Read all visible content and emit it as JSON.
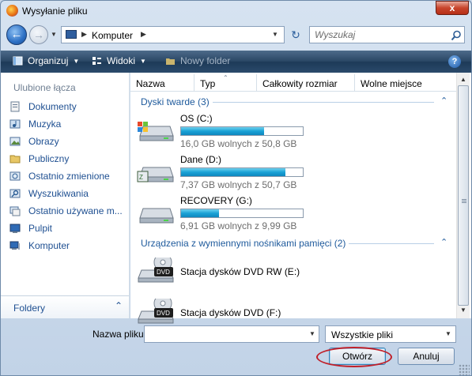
{
  "window": {
    "title": "Wysyłanie pliku",
    "close_glyph": "x"
  },
  "nav": {
    "address_segment": "Komputer",
    "search_placeholder": "Wyszukaj"
  },
  "toolbar": {
    "organize_label": "Organizuj",
    "views_label": "Widoki",
    "new_folder_label": "Nowy folder",
    "help_glyph": "?"
  },
  "sidebar": {
    "header": "Ulubione łącza",
    "items": [
      {
        "label": "Dokumenty",
        "icon": "documents-icon"
      },
      {
        "label": "Muzyka",
        "icon": "music-icon"
      },
      {
        "label": "Obrazy",
        "icon": "pictures-icon"
      },
      {
        "label": "Publiczny",
        "icon": "public-folder-icon"
      },
      {
        "label": "Ostatnio zmienione",
        "icon": "recent-icon"
      },
      {
        "label": "Wyszukiwania",
        "icon": "searches-icon"
      },
      {
        "label": "Ostatnio używane m...",
        "icon": "recent-places-icon"
      },
      {
        "label": "Pulpit",
        "icon": "desktop-icon"
      },
      {
        "label": "Komputer",
        "icon": "computer-icon"
      }
    ],
    "folders_label": "Foldery"
  },
  "columns": {
    "name": "Nazwa",
    "type": "Typ",
    "total_size": "Całkowity rozmiar",
    "free_space": "Wolne miejsce"
  },
  "groups": {
    "hard_disks": "Dyski twarde (3)",
    "removable": "Urządzenia z wymiennymi nośnikami pamięci (2)"
  },
  "drives": [
    {
      "name": "OS (C:)",
      "free_text": "16,0 GB wolnych z 50,8 GB",
      "used_fraction": 0.685
    },
    {
      "name": "Dane (D:)",
      "free_text": "7,37 GB wolnych z 50,7 GB",
      "used_fraction": 0.855
    },
    {
      "name": "RECOVERY (G:)",
      "free_text": "6,91 GB wolnych z 9,99 GB",
      "used_fraction": 0.31
    }
  ],
  "devices": [
    {
      "name": "Stacja dysków DVD RW (E:)",
      "badge": "DVD"
    },
    {
      "name": "Stacja dysków DVD (F:)",
      "badge": "DVD"
    }
  ],
  "bottom": {
    "filename_label": "Nazwa pliku:",
    "filename_value": "",
    "filter_value": "Wszystkie pliki",
    "open_label": "Otwórz",
    "cancel_label": "Anuluj"
  },
  "colors": {
    "accent_link": "#1e4f91",
    "bar_fill": "#1aa2d6",
    "highlight": "#c0202a"
  }
}
